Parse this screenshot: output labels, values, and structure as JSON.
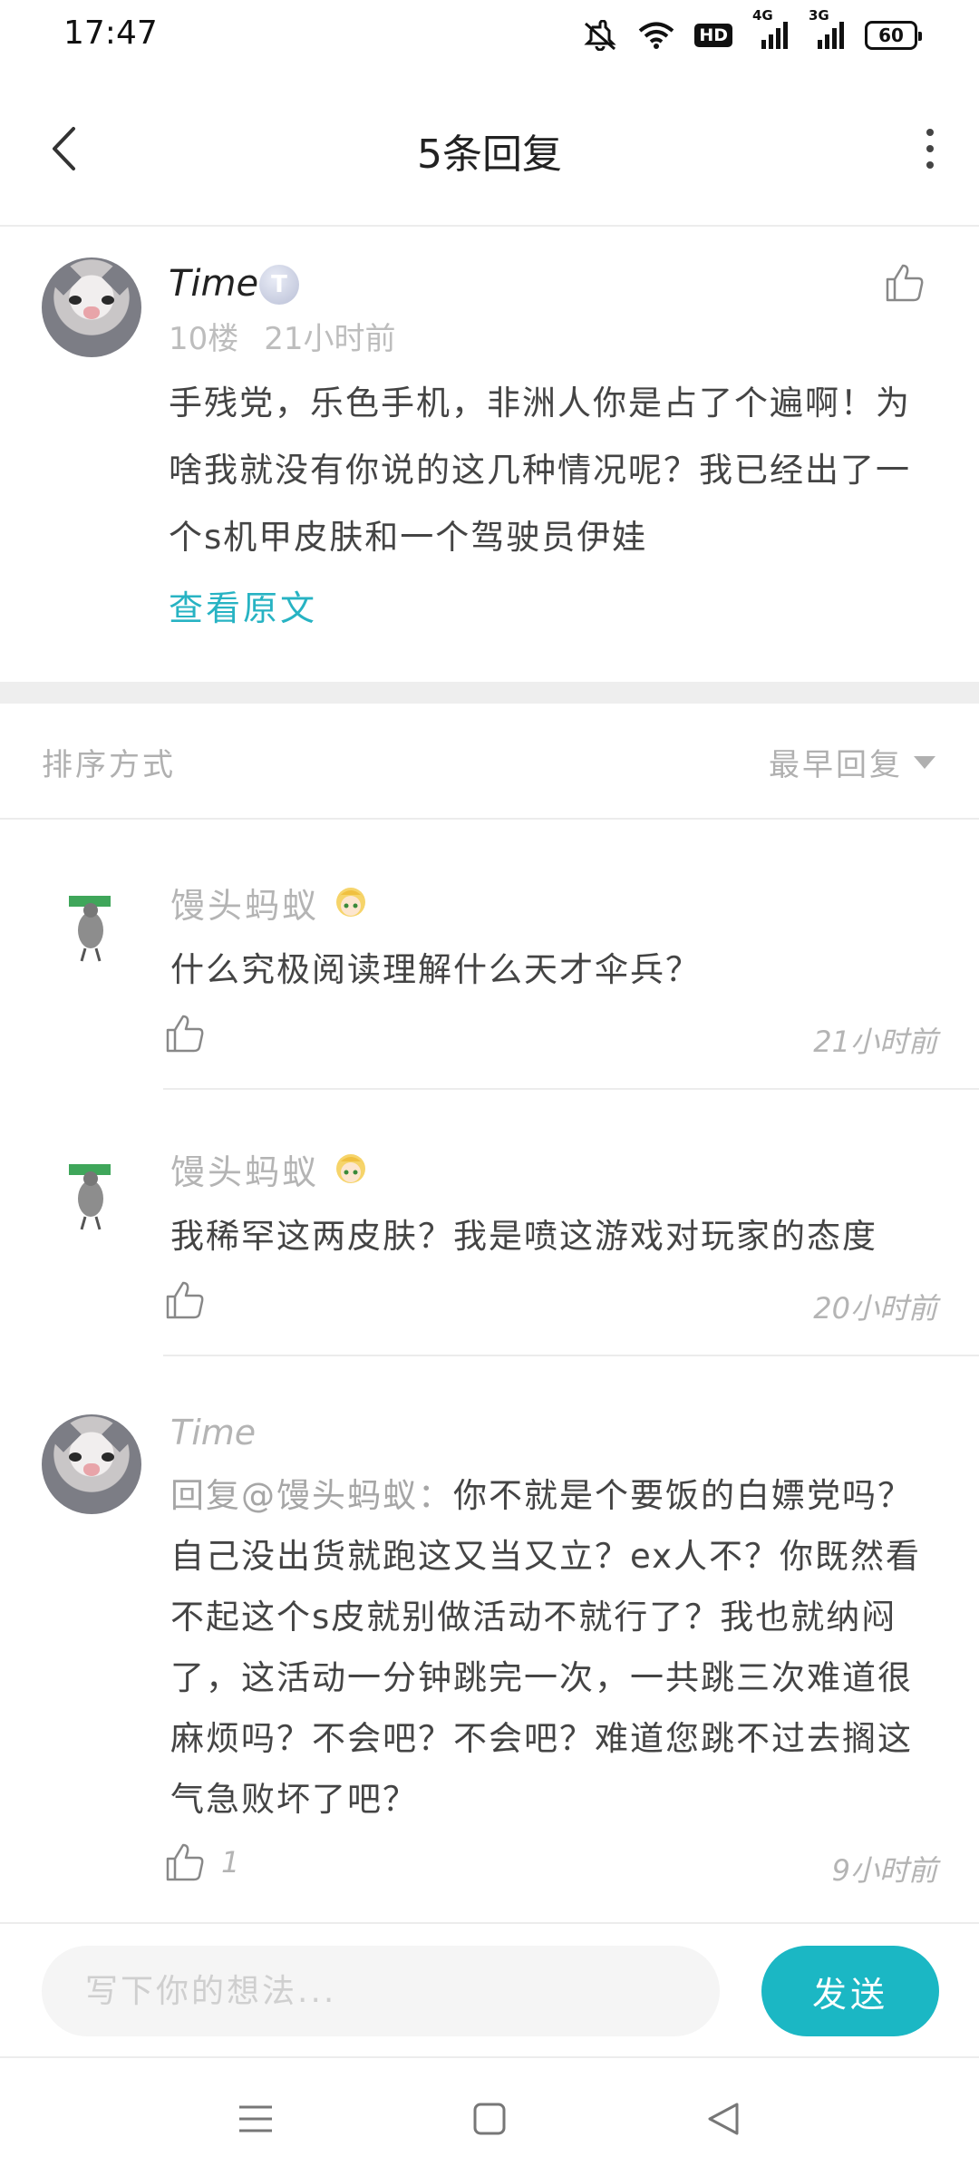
{
  "status_bar": {
    "time": "17:47",
    "network_1": "4G",
    "network_2": "3G",
    "hd_label": "HD",
    "battery": "60"
  },
  "header": {
    "title": "5条回复"
  },
  "post": {
    "author": "Time",
    "level": "T",
    "floor": "10楼",
    "time": "21小时前",
    "text": "手残党，乐色手机，非洲人你是占了个遍啊！为啥我就没有你说的这几种情况呢？我已经出了一个s机甲皮肤和一个驾驶员伊娃",
    "view_original": "查看原文"
  },
  "sort": {
    "label": "排序方式",
    "value": "最早回复"
  },
  "replies": [
    {
      "author": "馒头蚂蚁",
      "text": "什么究极阅读理解什么天才伞兵？",
      "likes": "",
      "time": "21小时前"
    },
    {
      "author": "馒头蚂蚁",
      "text": "我稀罕这两皮肤？我是喷这游戏对玩家的态度",
      "likes": "",
      "time": "20小时前"
    },
    {
      "author": "Time",
      "mention": "回复@馒头蚂蚁：",
      "text": "你不就是个要饭的白嫖党吗？自己没出货就跑这又当又立？ex人不？你既然看不起这个s皮就别做活动不就行了？我也就纳闷了，这活动一分钟跳完一次，一共跳三次难道很麻烦吗？不会吧？不会吧？难道您跳不过去搁这气急败坏了吧？",
      "likes": "1",
      "time": "9小时前"
    }
  ],
  "input": {
    "placeholder": "写下你的想法...",
    "send_label": "发送"
  },
  "colors": {
    "accent": "#1bb7c4",
    "link": "#27b3c3",
    "muted": "#b4b4b4"
  }
}
